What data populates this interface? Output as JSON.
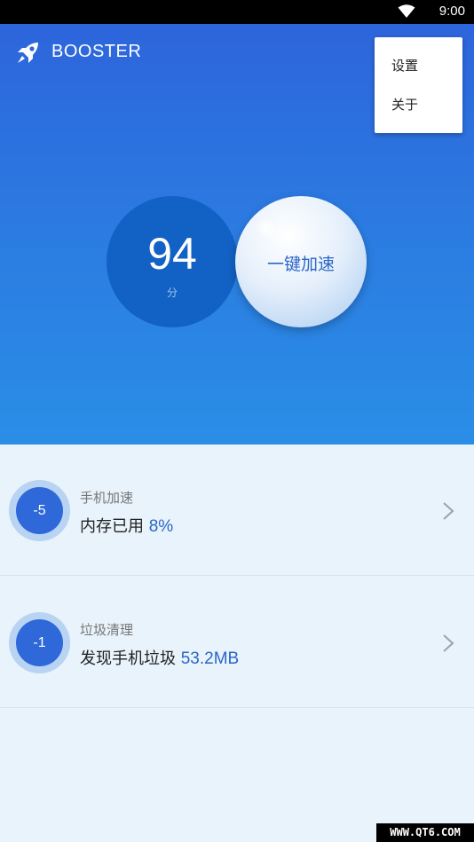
{
  "status_bar": {
    "time": "9:00"
  },
  "app": {
    "title": "BOOSTER"
  },
  "score": {
    "value": "94",
    "unit": "分"
  },
  "boost_button": {
    "label": "一键加速"
  },
  "menu": {
    "items": [
      {
        "label": "设置"
      },
      {
        "label": "关于"
      }
    ]
  },
  "rows": [
    {
      "badge": "-5",
      "title": "手机加速",
      "detail": "内存已用",
      "value": "8%"
    },
    {
      "badge": "-1",
      "title": "垃圾清理",
      "detail": "发现手机垃圾",
      "value": "53.2MB"
    }
  ],
  "watermark": "WWW.QT6.COM",
  "colors": {
    "primary": "#2b6ddf",
    "score_bg": "#1261c4",
    "accent_text": "#2b66c7",
    "list_bg": "#e8f3fb"
  }
}
